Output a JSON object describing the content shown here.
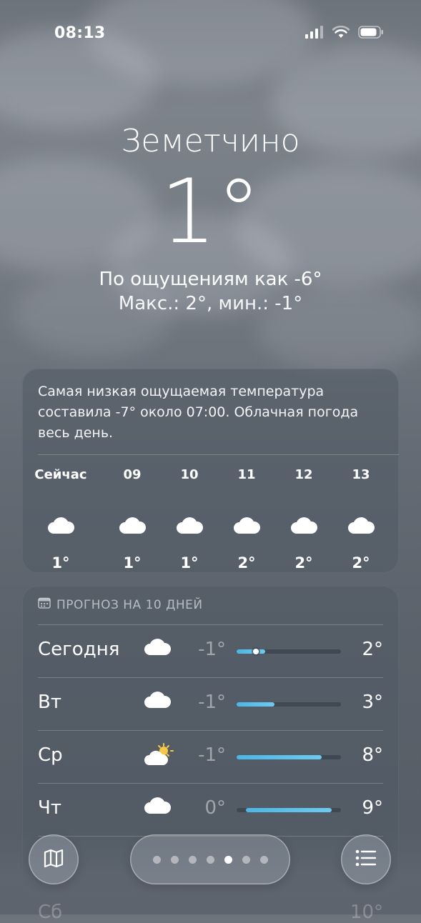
{
  "status_bar": {
    "time": "08:13",
    "icons": [
      "signal-icon",
      "wifi-icon",
      "battery-icon"
    ]
  },
  "location": {
    "city": "Земетчино",
    "temperature": "1°",
    "feels_like": "По ощущениям как -6°",
    "high_low": "Макс.: 2°, мин.: -1°"
  },
  "hourly": {
    "summary": "Самая низкая ощущаемая температура составила -7° около 07:00. Облачная погода весь день.",
    "items": [
      {
        "time": "Сейчас",
        "icon": "cloud-icon",
        "temp": "1°"
      },
      {
        "time": "09",
        "icon": "cloud-icon",
        "temp": "1°"
      },
      {
        "time": "10",
        "icon": "cloud-icon",
        "temp": "1°"
      },
      {
        "time": "11",
        "icon": "cloud-icon",
        "temp": "2°"
      },
      {
        "time": "12",
        "icon": "cloud-icon",
        "temp": "2°"
      },
      {
        "time": "13",
        "icon": "cloud-icon",
        "temp": "2°"
      }
    ]
  },
  "daily": {
    "header": "ПРОГНОЗ НА 10 ДНЕЙ",
    "header_icon": "calendar-icon",
    "range": [
      -1,
      10
    ],
    "days": [
      {
        "name": "Сегодня",
        "icon": "cloud-icon",
        "low": "-1°",
        "high": "2°",
        "low_value": -1,
        "high_value": 2,
        "current_value": 1
      },
      {
        "name": "Вт",
        "icon": "cloud-icon",
        "low": "-1°",
        "high": "3°",
        "low_value": -1,
        "high_value": 3
      },
      {
        "name": "Ср",
        "icon": "partly-sunny-icon",
        "low": "-1°",
        "high": "8°",
        "low_value": -1,
        "high_value": 8
      },
      {
        "name": "Чт",
        "icon": "cloud-icon",
        "low": "0°",
        "high": "9°",
        "low_value": 0,
        "high_value": 9
      }
    ],
    "partial_row": {
      "name": "Сб",
      "high": "10°"
    }
  },
  "bottom_bar": {
    "left_icon": "map-icon",
    "right_icon": "list-icon",
    "page_count": 7,
    "active_page": 5
  },
  "colors": {
    "bar_fill": "#5bc0eb",
    "background": "#6b727a"
  }
}
